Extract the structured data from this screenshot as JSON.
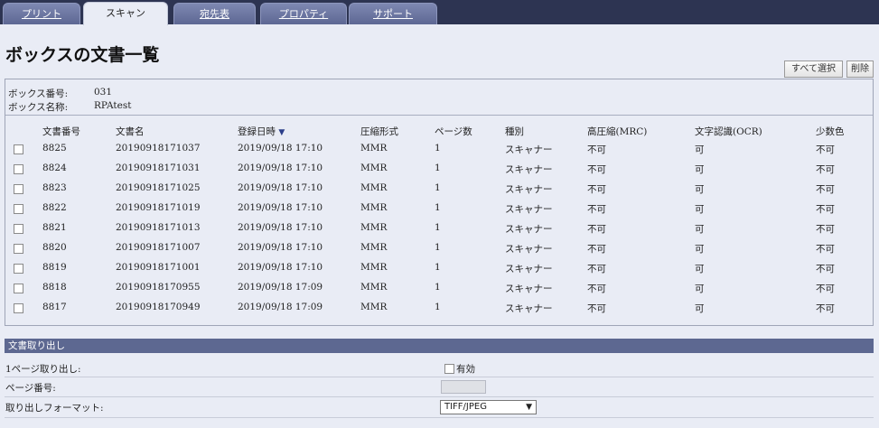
{
  "tabs": [
    {
      "label": "プリント",
      "active": false
    },
    {
      "label": "スキャン",
      "active": true
    },
    {
      "label": "宛先表",
      "active": false
    },
    {
      "label": "プロパティ",
      "active": false
    },
    {
      "label": "サポート",
      "active": false
    }
  ],
  "page_title": "ボックスの文書一覧",
  "toolbar": {
    "select_all_label": "すべて選択",
    "delete_label": "削除"
  },
  "box_info": {
    "number_label": "ボックス番号:",
    "number_value": "031",
    "name_label": "ボックス名称:",
    "name_value": "RPAtest"
  },
  "table": {
    "headers": {
      "doc_no": "文書番号",
      "doc_name": "文書名",
      "reg_date": "登録日時",
      "compression": "圧縮形式",
      "pages": "ページ数",
      "type": "種別",
      "mrc": "高圧縮(MRC)",
      "ocr": "文字認識(OCR)",
      "few_colors": "少数色"
    },
    "sort_indicator": "▼",
    "rows": [
      {
        "doc_no": "8825",
        "doc_name": "20190918171037",
        "reg_date": "2019/09/18 17:10",
        "compression": "MMR",
        "pages": "1",
        "type": "スキャナー",
        "mrc": "不可",
        "ocr": "可",
        "few_colors": "不可"
      },
      {
        "doc_no": "8824",
        "doc_name": "20190918171031",
        "reg_date": "2019/09/18 17:10",
        "compression": "MMR",
        "pages": "1",
        "type": "スキャナー",
        "mrc": "不可",
        "ocr": "可",
        "few_colors": "不可"
      },
      {
        "doc_no": "8823",
        "doc_name": "20190918171025",
        "reg_date": "2019/09/18 17:10",
        "compression": "MMR",
        "pages": "1",
        "type": "スキャナー",
        "mrc": "不可",
        "ocr": "可",
        "few_colors": "不可"
      },
      {
        "doc_no": "8822",
        "doc_name": "20190918171019",
        "reg_date": "2019/09/18 17:10",
        "compression": "MMR",
        "pages": "1",
        "type": "スキャナー",
        "mrc": "不可",
        "ocr": "可",
        "few_colors": "不可"
      },
      {
        "doc_no": "8821",
        "doc_name": "20190918171013",
        "reg_date": "2019/09/18 17:10",
        "compression": "MMR",
        "pages": "1",
        "type": "スキャナー",
        "mrc": "不可",
        "ocr": "可",
        "few_colors": "不可"
      },
      {
        "doc_no": "8820",
        "doc_name": "20190918171007",
        "reg_date": "2019/09/18 17:10",
        "compression": "MMR",
        "pages": "1",
        "type": "スキャナー",
        "mrc": "不可",
        "ocr": "可",
        "few_colors": "不可"
      },
      {
        "doc_no": "8819",
        "doc_name": "20190918171001",
        "reg_date": "2019/09/18 17:10",
        "compression": "MMR",
        "pages": "1",
        "type": "スキャナー",
        "mrc": "不可",
        "ocr": "可",
        "few_colors": "不可"
      },
      {
        "doc_no": "8818",
        "doc_name": "20190918170955",
        "reg_date": "2019/09/18 17:09",
        "compression": "MMR",
        "pages": "1",
        "type": "スキャナー",
        "mrc": "不可",
        "ocr": "可",
        "few_colors": "不可"
      },
      {
        "doc_no": "8817",
        "doc_name": "20190918170949",
        "reg_date": "2019/09/18 17:09",
        "compression": "MMR",
        "pages": "1",
        "type": "スキャナー",
        "mrc": "不可",
        "ocr": "可",
        "few_colors": "不可"
      }
    ]
  },
  "retrieve": {
    "section_title": "文書取り出し",
    "single_page_label": "1ページ取り出し:",
    "enable_label": "有効",
    "page_number_label": "ページ番号:",
    "page_number_value": "",
    "format_label": "取り出しフォーマット:",
    "format_value": "TIFF/JPEG"
  },
  "colors": {
    "tab_bar": "#2d3452",
    "section_bar": "#5d6891",
    "background": "#e9ecf5",
    "sort_arrow": "#2c3f8a"
  }
}
